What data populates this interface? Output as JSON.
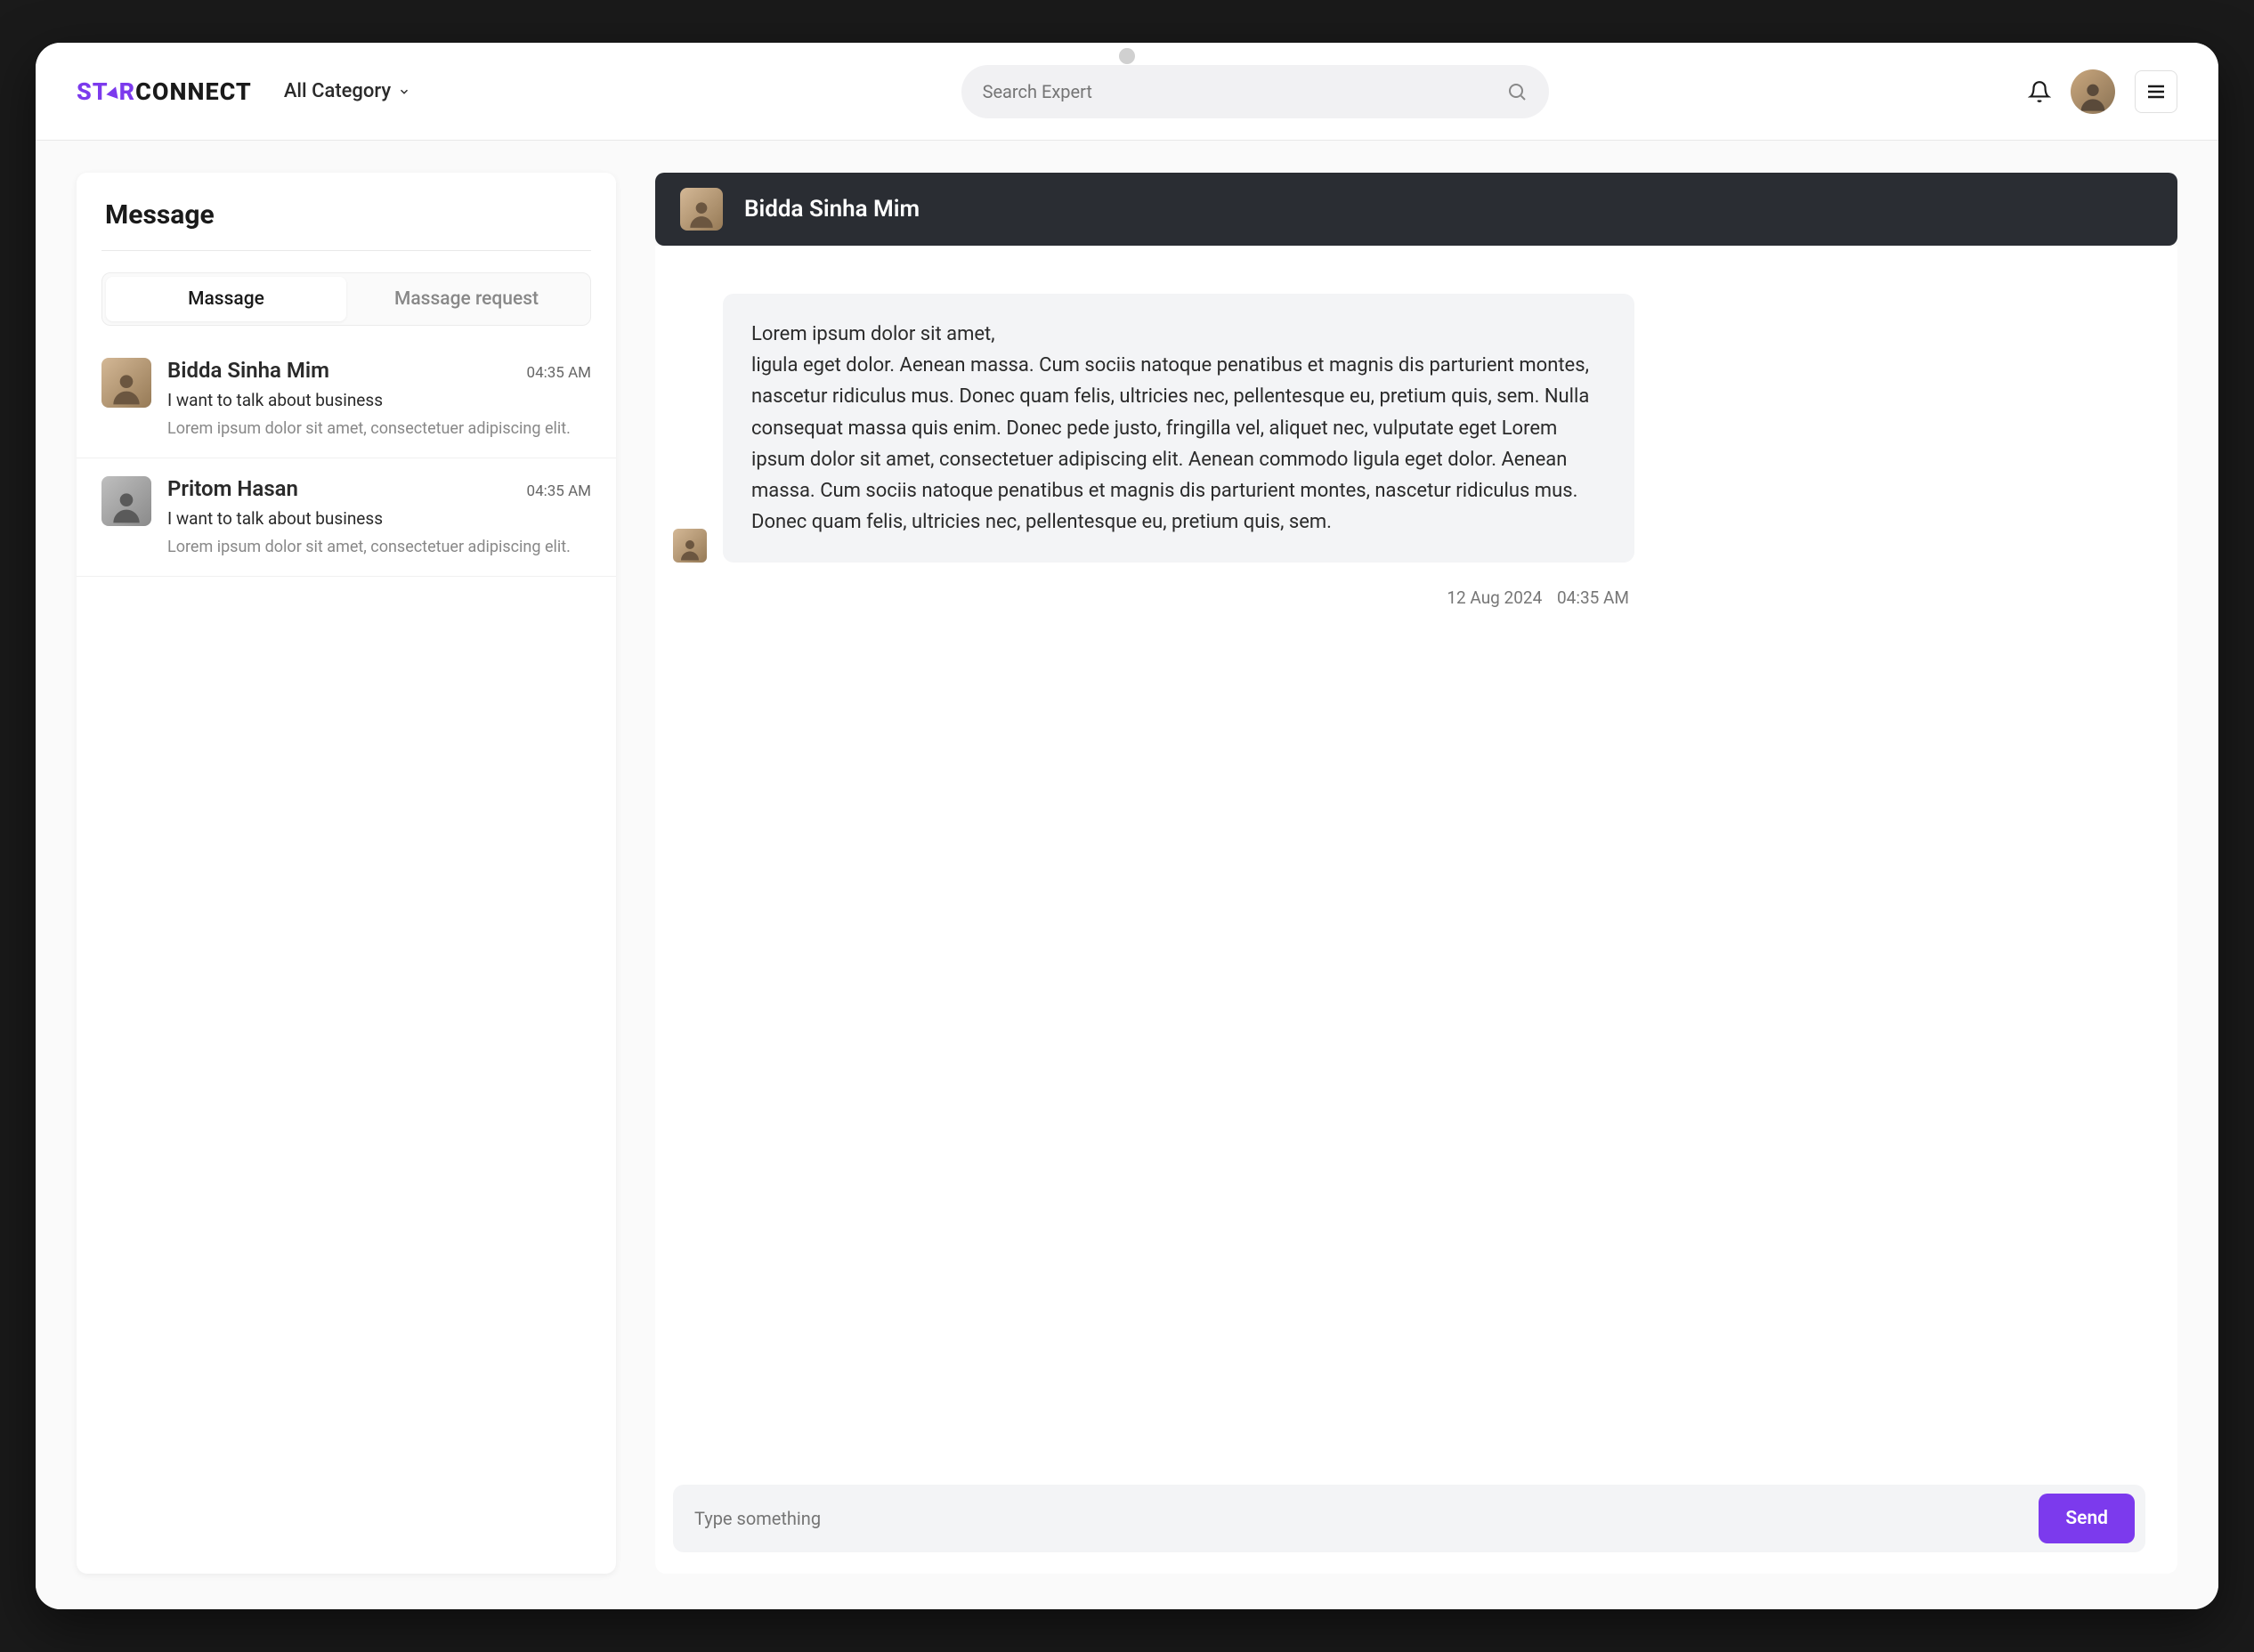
{
  "brand": {
    "logo_left": "ST",
    "logo_mid": "R",
    "logo_right": "CONNECT"
  },
  "header": {
    "category_label": "All Category",
    "search_placeholder": "Search Expert"
  },
  "sidebar": {
    "title": "Message",
    "tabs": [
      {
        "label": "Massage",
        "active": true
      },
      {
        "label": "Massage request",
        "active": false
      }
    ],
    "conversations": [
      {
        "name": "Bidda Sinha Mim",
        "time": "04:35 AM",
        "subject": "I want to talk about business",
        "preview": "Lorem ipsum dolor sit amet, consectetuer adipiscing elit."
      },
      {
        "name": "Pritom Hasan",
        "time": "04:35 AM",
        "subject": "I want to talk about business",
        "preview": "Lorem ipsum dolor sit amet, consectetuer adipiscing elit."
      }
    ]
  },
  "chat": {
    "contact_name": "Bidda Sinha Mim",
    "messages": [
      {
        "text": "Lorem ipsum dolor sit amet,\nligula eget dolor. Aenean massa. Cum sociis natoque penatibus et magnis dis parturient montes, nascetur ridiculus mus. Donec quam felis, ultricies nec, pellentesque eu, pretium quis, sem. Nulla consequat massa quis enim. Donec pede justo, fringilla vel, aliquet nec, vulputate eget Lorem ipsum dolor sit amet, consectetuer adipiscing elit. Aenean commodo ligula eget dolor. Aenean massa. Cum sociis natoque penatibus et magnis dis parturient montes, nascetur ridiculus mus. Donec quam felis, ultricies nec, pellentesque eu, pretium quis, sem.",
        "date": "12 Aug 2024",
        "time": "04:35 AM"
      }
    ],
    "composer_placeholder": "Type something",
    "send_label": "Send"
  },
  "colors": {
    "accent": "#7c3aed"
  }
}
